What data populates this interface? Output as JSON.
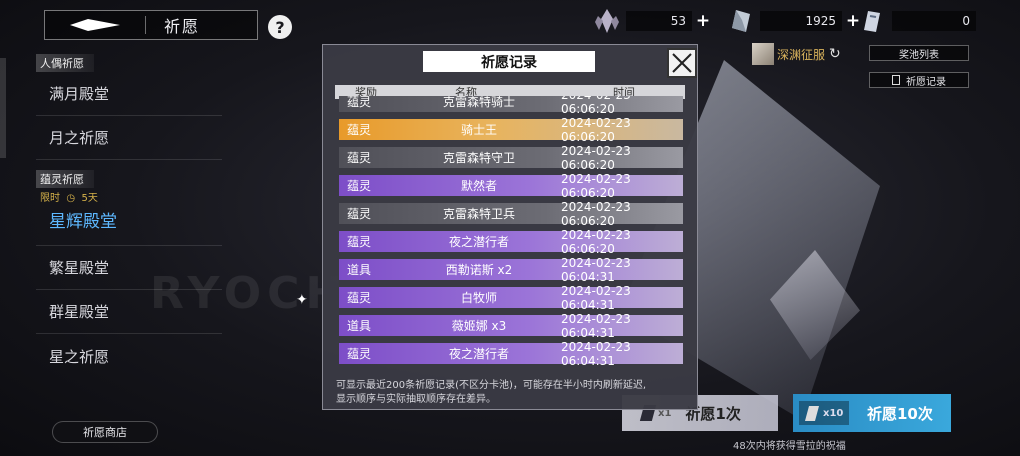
{
  "topbar": {
    "page_title": "祈愿",
    "help_label": "?",
    "currencies": [
      {
        "icon": "crystal-icon",
        "value": "53"
      },
      {
        "icon": "gem-icon",
        "value": "1925"
      },
      {
        "icon": "ticket-icon",
        "value": "0"
      }
    ]
  },
  "sidebar": {
    "section1_label": "人偶祈愿",
    "items1": [
      "满月殿堂",
      "月之祈愿"
    ],
    "section2_label": "蕴灵祈愿",
    "limit_prefix": "限时",
    "limit_days": "5天",
    "active_item": "星辉殿堂",
    "items2": [
      "繁星殿堂",
      "群星殿堂",
      "星之祈愿"
    ],
    "shop_label": "祈愿商店"
  },
  "right_panel": {
    "abyss_label": "深渊征服",
    "pool_list_label": "奖池列表",
    "record_label": "祈愿记录"
  },
  "pray": {
    "single_mult": "x1",
    "single_label": "祈愿1次",
    "ten_mult": "x10",
    "ten_label": "祈愿10次",
    "footer_note": "48次内将获得雪拉的祝福"
  },
  "modal": {
    "title": "祈愿记录",
    "columns": [
      "奖励",
      "名称",
      "时间"
    ],
    "rows": [
      {
        "type": "蕴灵",
        "name": "克雷森特骑士",
        "time": "2024-02-23 06:06:20",
        "rarity": "gray"
      },
      {
        "type": "蕴灵",
        "name": "骑士王",
        "time": "2024-02-23 06:06:20",
        "rarity": "gold"
      },
      {
        "type": "蕴灵",
        "name": "克雷森特守卫",
        "time": "2024-02-23 06:06:20",
        "rarity": "gray"
      },
      {
        "type": "蕴灵",
        "name": "默然者",
        "time": "2024-02-23 06:06:20",
        "rarity": "purple"
      },
      {
        "type": "蕴灵",
        "name": "克雷森特卫兵",
        "time": "2024-02-23 06:06:20",
        "rarity": "gray"
      },
      {
        "type": "蕴灵",
        "name": "夜之潜行者",
        "time": "2024-02-23 06:06:20",
        "rarity": "purple"
      },
      {
        "type": "道具",
        "name": "西勒诺斯 x2",
        "time": "2024-02-23 06:04:31",
        "rarity": "purple"
      },
      {
        "type": "蕴灵",
        "name": "白牧师",
        "time": "2024-02-23 06:04:31",
        "rarity": "purple"
      },
      {
        "type": "道具",
        "name": "薇姬娜 x3",
        "time": "2024-02-23 06:04:31",
        "rarity": "purple"
      },
      {
        "type": "蕴灵",
        "name": "夜之潜行者",
        "time": "2024-02-23 06:04:31",
        "rarity": "purple"
      }
    ],
    "note_line1": "可显示最近200条祈愿记录(不区分卡池)，可能存在半小时内刷新延迟,",
    "note_line2": "显示顺序与实际抽取顺序存在差异。"
  },
  "colors": {
    "gray": "#56565e",
    "gold": "#e6a238",
    "purple": "#8a5bd0",
    "accent_blue": "#5db8ff"
  }
}
